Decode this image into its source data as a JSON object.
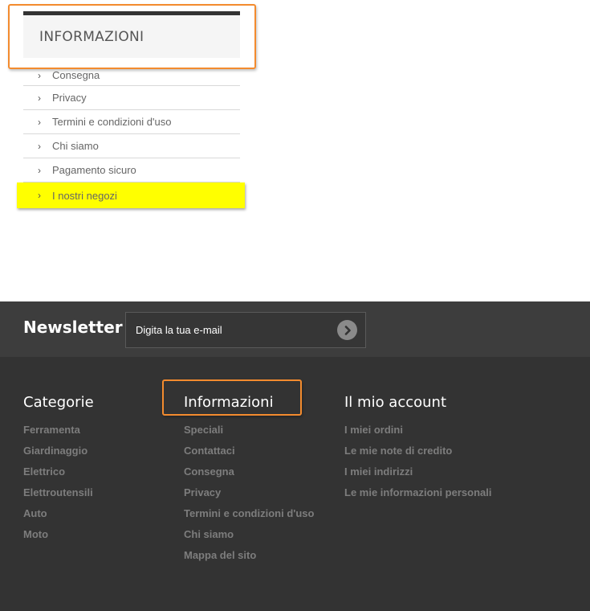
{
  "info_block": {
    "title": "INFORMAZIONI",
    "items": [
      {
        "label": "Consegna"
      },
      {
        "label": "Privacy"
      },
      {
        "label": "Termini e condizioni d'uso"
      },
      {
        "label": "Chi siamo"
      },
      {
        "label": "Pagamento sicuro"
      },
      {
        "label": "I nostri negozi",
        "highlighted": true
      }
    ]
  },
  "newsletter": {
    "title": "Newsletter",
    "placeholder": "Digita la tua e-mail",
    "submit_icon": "chevron-circle-right-icon"
  },
  "footer": {
    "columns": [
      {
        "heading": "Categorie",
        "links": [
          "Ferramenta",
          "Giardinaggio",
          "Elettrico",
          "Elettroutensili",
          "Auto",
          "Moto"
        ]
      },
      {
        "heading": "Informazioni",
        "links": [
          "Speciali",
          "Contattaci",
          "Consegna",
          "Privacy",
          "Termini e condizioni d'uso",
          "Chi siamo",
          "Mappa del sito"
        ]
      },
      {
        "heading": "Il mio account",
        "links": [
          "I miei ordini",
          "Le mie note di credito",
          "I miei indirizzi",
          "Le mie informazioni personali"
        ]
      }
    ]
  },
  "colors": {
    "highlight": "#ffff00",
    "annotation_border": "#f38b2e",
    "footer_bg": "#333333",
    "newsletter_bg": "#3d3d3d"
  }
}
